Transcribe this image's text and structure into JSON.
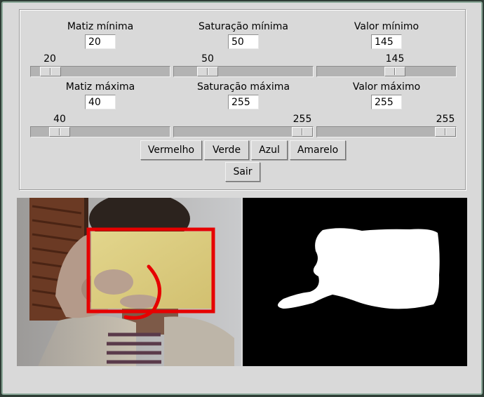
{
  "hue_min": {
    "label": "Matiz mínima",
    "value": "20",
    "slider_value": "20",
    "slider_level": 20,
    "slider_max": 255
  },
  "sat_min": {
    "label": "Saturação mínima",
    "value": "50",
    "slider_value": "50",
    "slider_level": 50,
    "slider_max": 255
  },
  "val_min": {
    "label": "Valor mínimo",
    "value": "145",
    "slider_value": "145",
    "slider_level": 145,
    "slider_max": 255
  },
  "hue_max": {
    "label": "Matiz máxima",
    "value": "40",
    "slider_value": "40",
    "slider_level": 40,
    "slider_max": 255
  },
  "sat_max": {
    "label": "Saturação máxima",
    "value": "255",
    "slider_value": "255",
    "slider_level": 255,
    "slider_max": 255
  },
  "val_max": {
    "label": "Valor máximo",
    "value": "255",
    "slider_value": "255",
    "slider_level": 255,
    "slider_max": 255
  },
  "buttons": {
    "red": "Vermelho",
    "green": "Verde",
    "blue": "Azul",
    "yellow": "Amarelo",
    "quit": "Sair"
  },
  "colors": {
    "window_bg": "#d9d9d9",
    "detection_box": "#e60000",
    "mask_fg": "#ffffff",
    "mask_bg": "#000000"
  }
}
